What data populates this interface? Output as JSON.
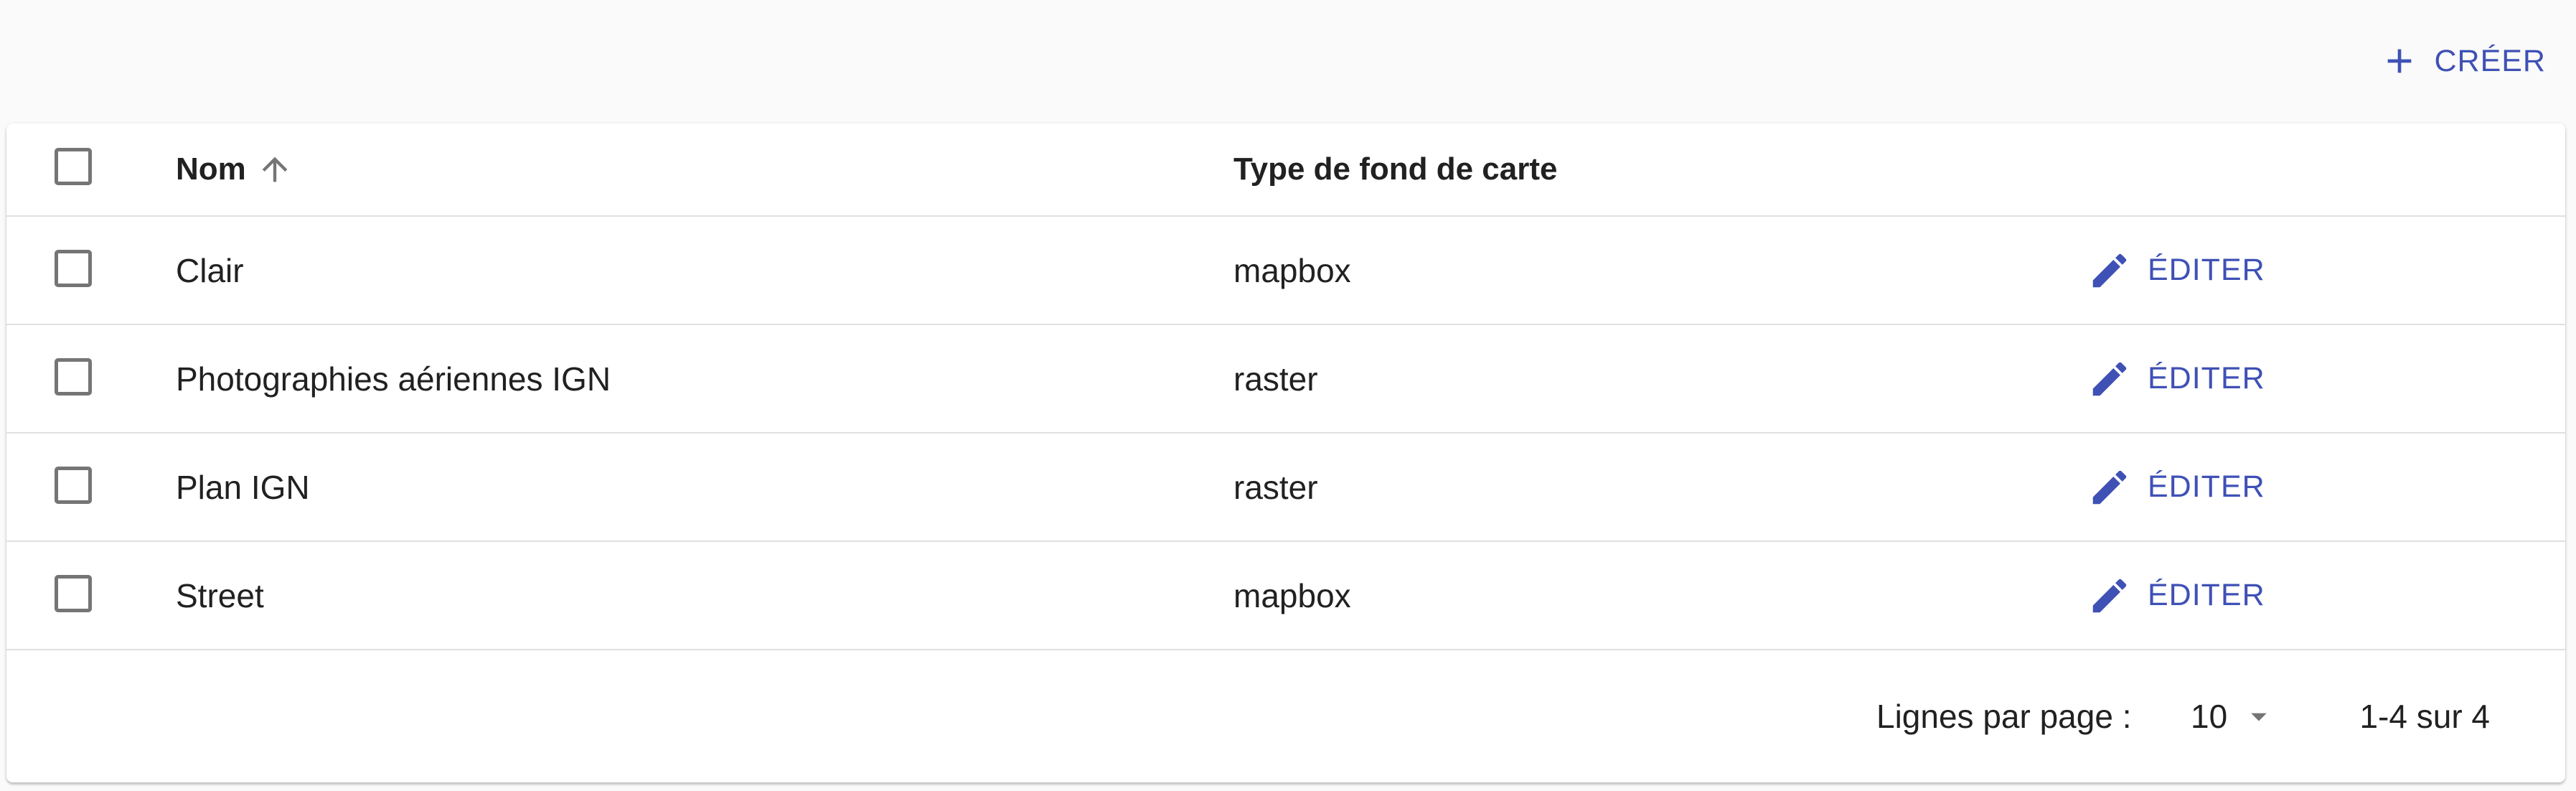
{
  "toolbar": {
    "create_label": "CRÉER"
  },
  "table": {
    "columns": {
      "name": "Nom",
      "type": "Type de fond de carte"
    },
    "sort": {
      "column": "Nom",
      "direction": "ascending"
    },
    "rows": [
      {
        "name": "Clair",
        "type": "mapbox",
        "edit_label": "ÉDITER"
      },
      {
        "name": "Photographies aériennes IGN",
        "type": "raster",
        "edit_label": "ÉDITER"
      },
      {
        "name": "Plan IGN",
        "type": "raster",
        "edit_label": "ÉDITER"
      },
      {
        "name": "Street",
        "type": "mapbox",
        "edit_label": "ÉDITER"
      }
    ]
  },
  "pagination": {
    "rows_per_page_label": "Lignes par page :",
    "rows_per_page_value": "10",
    "range_label": "1-4 sur 4"
  },
  "icons": {
    "create": "plus-icon",
    "sort": "arrow-up-icon",
    "edit": "pencil-icon",
    "dropdown": "caret-down-icon"
  },
  "colors": {
    "accent": "#3f51b5",
    "background": "#fafafa",
    "card": "#ffffff",
    "divider": "#e0e0e0",
    "checkbox": "#757575",
    "text": "#212121"
  }
}
